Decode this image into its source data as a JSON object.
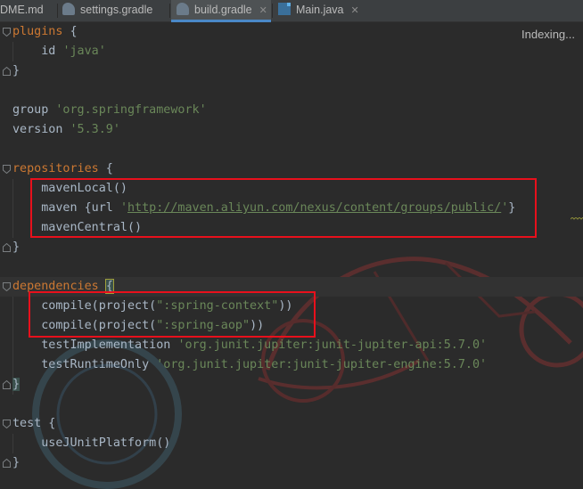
{
  "tabs": [
    {
      "label": "DME.md",
      "icon": "markdown-file-icon",
      "active": false
    },
    {
      "label": "settings.gradle",
      "icon": "gradle-elephant-icon",
      "active": false
    },
    {
      "label": "build.gradle",
      "icon": "gradle-elephant-icon",
      "active": true
    },
    {
      "label": "Main.java",
      "icon": "java-file-icon",
      "active": false
    }
  ],
  "status": {
    "indexing": "Indexing..."
  },
  "code": {
    "l1_kw": "plugins",
    "l1_rest": " {",
    "l2_id": "id",
    "l2_str": "'java'",
    "l3": "}",
    "l5_kw": "group",
    "l5_str": "'org.springframework'",
    "l6_kw": "version",
    "l6_str": "'5.3.9'",
    "l8_kw": "repositories",
    "l8_rest": " {",
    "l9": "mavenLocal()",
    "l10_a": "maven {url ",
    "l10_q1": "'",
    "l10_url": "http://maven.aliyun.com/nexus/content/groups/public/",
    "l10_q2": "'",
    "l10_b": "}",
    "l11": "mavenCentral()",
    "l12": "}",
    "l14_kw": "dependencies",
    "l14_sp": " ",
    "l14_brace": "{",
    "l15_a": "compile(project(",
    "l15_s": "\":spring-context\"",
    "l15_b": "))",
    "l16_a": "compile(project(",
    "l16_s": "\":spring-aop\"",
    "l16_b": "))",
    "l17_a": "testImplementation ",
    "l17_s": "'org.junit.jupiter:junit-jupiter-api:5.7.0'",
    "l18_a": "testRuntimeOnly ",
    "l18_s": "'org.junit.jupiter:junit-jupiter-engine:5.7.0'",
    "l19": "}",
    "l21_kw": "test",
    "l21_rest": " {",
    "l22": "useJUnitPlatform()",
    "l23": "}"
  },
  "colors": {
    "background": "#2b2b2b",
    "keyword": "#cc7832",
    "string": "#6a8759",
    "text": "#a9b7c6",
    "annotation_box": "#e8101c"
  }
}
